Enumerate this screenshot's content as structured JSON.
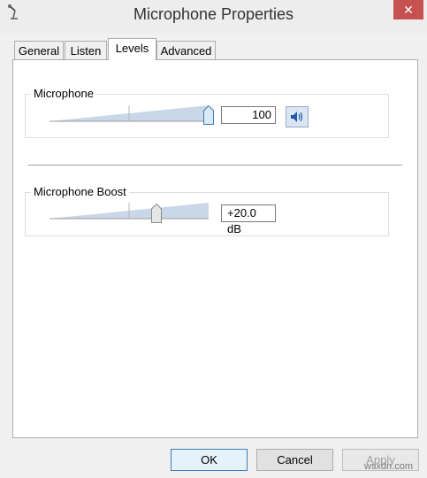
{
  "window": {
    "title": "Microphone Properties",
    "close_glyph": "✕",
    "app_icon": "microphone-icon"
  },
  "tabs": [
    {
      "label": "General",
      "active": false
    },
    {
      "label": "Listen",
      "active": false
    },
    {
      "label": "Levels",
      "active": true
    },
    {
      "label": "Advanced",
      "active": false
    }
  ],
  "levels": {
    "microphone": {
      "label": "Microphone",
      "value_text": "100",
      "level_fraction": 1.0,
      "mute_icon": "speaker-icon"
    },
    "boost": {
      "label": "Microphone Boost",
      "value_text": "+20.0 dB",
      "level_fraction": 0.67
    }
  },
  "buttons": {
    "ok": "OK",
    "cancel": "Cancel",
    "apply": "Apply"
  },
  "watermark": "wsxdn.com",
  "colors": {
    "close_red": "#c75050",
    "slider_fill": "#c9d7e8",
    "accent_blue": "#3c7fb1"
  }
}
